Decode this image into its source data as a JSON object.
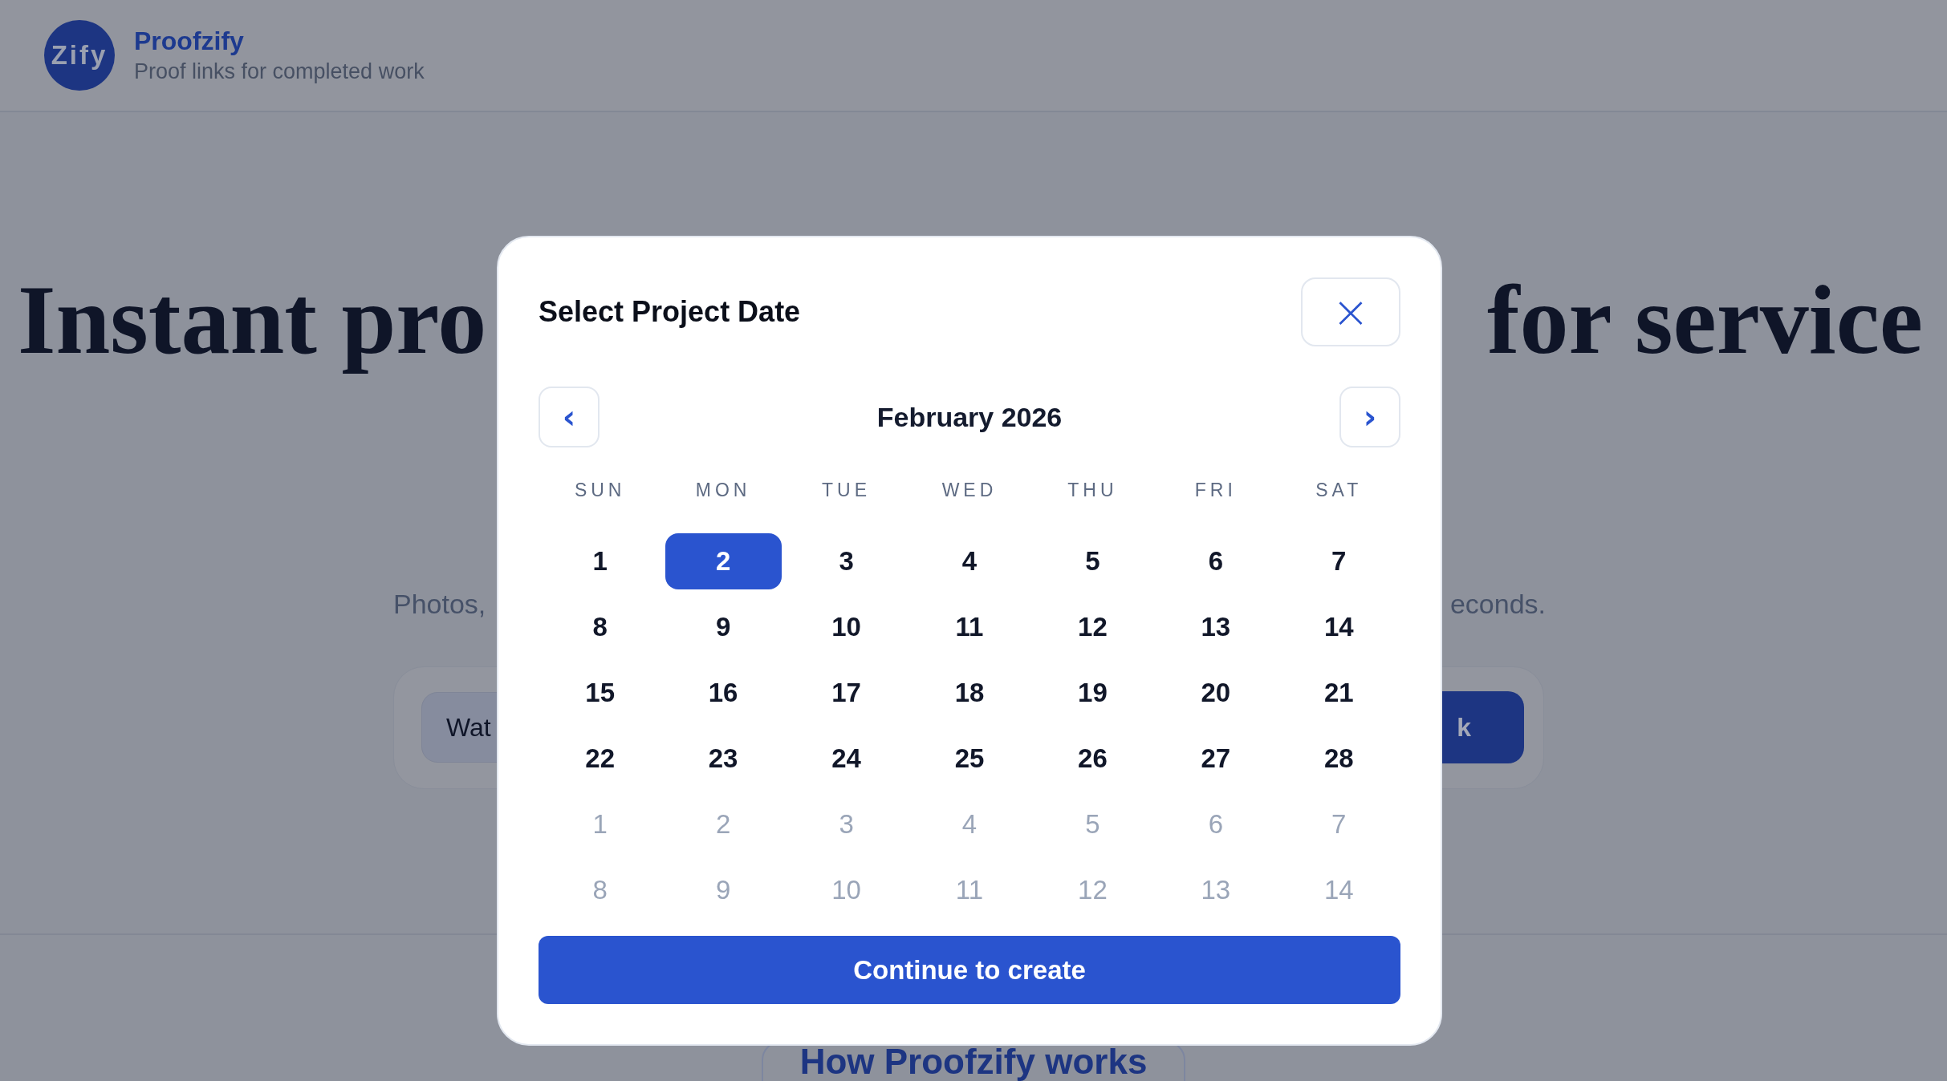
{
  "header": {
    "logo": "Zify",
    "brand": "Proofzify",
    "tagline": "Proof links for completed work"
  },
  "hero": {
    "heading_left": "Instant pro",
    "heading_right": "for service",
    "subtitle_left": "Photos,",
    "subtitle_right": "econds.",
    "input_value": "Wat",
    "button_label": "k"
  },
  "how_it_works": "How Proofzify works",
  "modal": {
    "title": "Select Project Date",
    "close": "×",
    "prev": "‹",
    "next": "›",
    "month": "February 2026",
    "weekdays": [
      "SUN",
      "MON",
      "TUE",
      "WED",
      "THU",
      "FRI",
      "SAT"
    ],
    "weeks": [
      [
        {
          "label": "1",
          "outside": false,
          "selected": false
        },
        {
          "label": "2",
          "outside": false,
          "selected": true
        },
        {
          "label": "3",
          "outside": false,
          "selected": false
        },
        {
          "label": "4",
          "outside": false,
          "selected": false
        },
        {
          "label": "5",
          "outside": false,
          "selected": false
        },
        {
          "label": "6",
          "outside": false,
          "selected": false
        },
        {
          "label": "7",
          "outside": false,
          "selected": false
        }
      ],
      [
        {
          "label": "8",
          "outside": false,
          "selected": false
        },
        {
          "label": "9",
          "outside": false,
          "selected": false
        },
        {
          "label": "10",
          "outside": false,
          "selected": false
        },
        {
          "label": "11",
          "outside": false,
          "selected": false
        },
        {
          "label": "12",
          "outside": false,
          "selected": false
        },
        {
          "label": "13",
          "outside": false,
          "selected": false
        },
        {
          "label": "14",
          "outside": false,
          "selected": false
        }
      ],
      [
        {
          "label": "15",
          "outside": false,
          "selected": false
        },
        {
          "label": "16",
          "outside": false,
          "selected": false
        },
        {
          "label": "17",
          "outside": false,
          "selected": false
        },
        {
          "label": "18",
          "outside": false,
          "selected": false
        },
        {
          "label": "19",
          "outside": false,
          "selected": false
        },
        {
          "label": "20",
          "outside": false,
          "selected": false
        },
        {
          "label": "21",
          "outside": false,
          "selected": false
        }
      ],
      [
        {
          "label": "22",
          "outside": false,
          "selected": false
        },
        {
          "label": "23",
          "outside": false,
          "selected": false
        },
        {
          "label": "24",
          "outside": false,
          "selected": false
        },
        {
          "label": "25",
          "outside": false,
          "selected": false
        },
        {
          "label": "26",
          "outside": false,
          "selected": false
        },
        {
          "label": "27",
          "outside": false,
          "selected": false
        },
        {
          "label": "28",
          "outside": false,
          "selected": false
        }
      ],
      [
        {
          "label": "1",
          "outside": true,
          "selected": false
        },
        {
          "label": "2",
          "outside": true,
          "selected": false
        },
        {
          "label": "3",
          "outside": true,
          "selected": false
        },
        {
          "label": "4",
          "outside": true,
          "selected": false
        },
        {
          "label": "5",
          "outside": true,
          "selected": false
        },
        {
          "label": "6",
          "outside": true,
          "selected": false
        },
        {
          "label": "7",
          "outside": true,
          "selected": false
        }
      ],
      [
        {
          "label": "8",
          "outside": true,
          "selected": false
        },
        {
          "label": "9",
          "outside": true,
          "selected": false
        },
        {
          "label": "10",
          "outside": true,
          "selected": false
        },
        {
          "label": "11",
          "outside": true,
          "selected": false
        },
        {
          "label": "12",
          "outside": true,
          "selected": false
        },
        {
          "label": "13",
          "outside": true,
          "selected": false
        },
        {
          "label": "14",
          "outside": true,
          "selected": false
        }
      ]
    ],
    "continue": "Continue to create"
  }
}
